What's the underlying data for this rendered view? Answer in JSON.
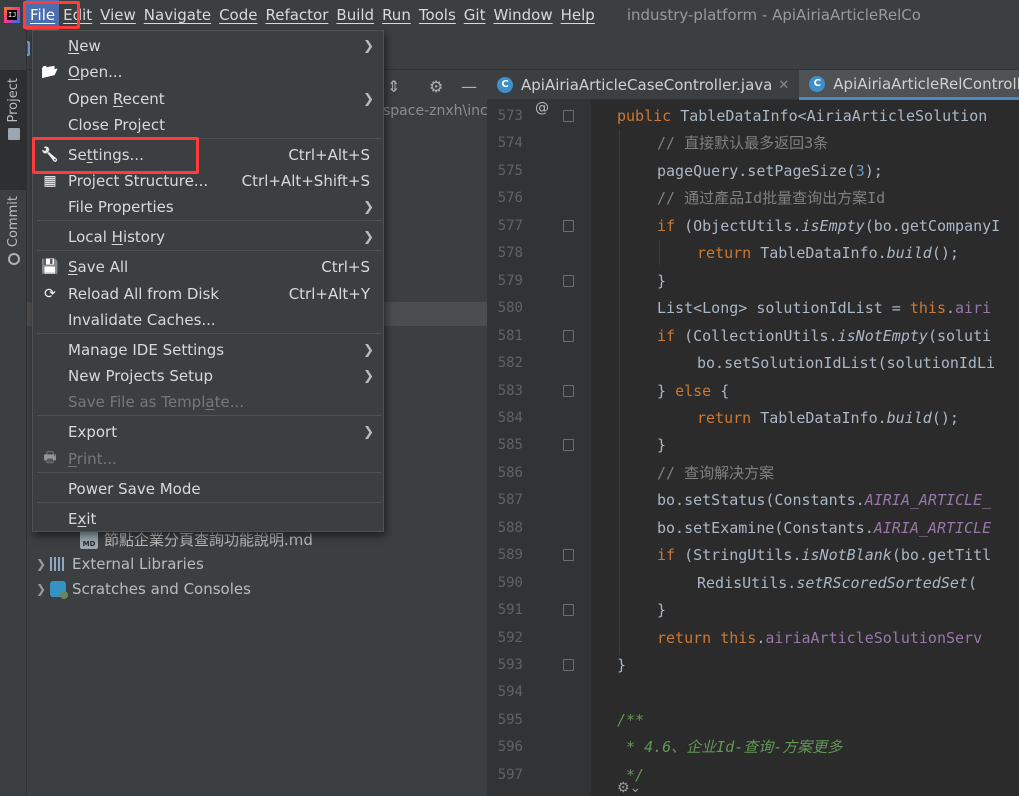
{
  "menubar": {
    "app_icon": "jetbrains-app-icon",
    "items": [
      "File",
      "Edit",
      "View",
      "Navigate",
      "Code",
      "Refactor",
      "Build",
      "Run",
      "Tools",
      "Git",
      "Window",
      "Help"
    ],
    "window_title": "industry-platform - ApiAiriaArticleRelCo"
  },
  "left_stripe": {
    "project_label": "Project",
    "commit_label": "Commit"
  },
  "project_panel": {
    "path_fragment": "space-znxh\\inc",
    "tree": [
      {
        "label": "節點企業分頁查詢功能說明.md",
        "icon": "markdown-file-icon"
      },
      {
        "label": "External Libraries",
        "icon": "library-icon"
      },
      {
        "label": "Scratches and Consoles",
        "icon": "scratches-icon"
      }
    ]
  },
  "editor": {
    "tabs": [
      {
        "label": "ApiAiriaArticleCaseController.java",
        "icon": "java-class-icon",
        "active": false
      },
      {
        "label": "ApiAiriaArticleRelControll",
        "icon": "java-class-icon",
        "active": true
      }
    ],
    "line_numbers": [
      "573",
      "574",
      "575",
      "576",
      "577",
      "578",
      "579",
      "580",
      "581",
      "582",
      "583",
      "584",
      "585",
      "586",
      "587",
      "588",
      "589",
      "590",
      "591",
      "592",
      "593",
      "594",
      "595",
      "596",
      "597"
    ],
    "lines": [
      {
        "indent": 0,
        "parts": [
          [
            "kw",
            "public "
          ],
          [
            "",
            "TableDataInfo<AiriaArticleSolution"
          ]
        ]
      },
      {
        "indent": 1,
        "parts": [
          [
            "cm",
            "// 直接默认最多返回3条"
          ]
        ]
      },
      {
        "indent": 1,
        "parts": [
          [
            "",
            "pageQuery.setPageSize("
          ],
          [
            "num",
            "3"
          ],
          [
            "",
            ");"
          ]
        ]
      },
      {
        "indent": 1,
        "parts": [
          [
            "cm",
            "// 通过產品Id批量查询出方案Id"
          ]
        ]
      },
      {
        "indent": 1,
        "parts": [
          [
            "kw",
            "if "
          ],
          [
            "",
            "(ObjectUtils."
          ],
          [
            "fn",
            "isEmpty"
          ],
          [
            "",
            "(bo.getCompanyI"
          ]
        ]
      },
      {
        "indent": 2,
        "parts": [
          [
            "kw",
            "return "
          ],
          [
            "",
            "TableDataInfo."
          ],
          [
            "fn",
            "build"
          ],
          [
            "",
            "();"
          ]
        ]
      },
      {
        "indent": 1,
        "parts": [
          [
            "",
            "}"
          ]
        ]
      },
      {
        "indent": 1,
        "parts": [
          [
            "",
            "List<Long> solutionIdList = "
          ],
          [
            "kw",
            "this"
          ],
          [
            "",
            "."
          ],
          [
            "fld",
            "airi"
          ]
        ]
      },
      {
        "indent": 1,
        "parts": [
          [
            "kw",
            "if "
          ],
          [
            "",
            "(CollectionUtils."
          ],
          [
            "fn",
            "isNotEmpty"
          ],
          [
            "",
            "(soluti"
          ]
        ]
      },
      {
        "indent": 2,
        "parts": [
          [
            "",
            "bo.setSolutionIdList(solutionIdLi"
          ]
        ]
      },
      {
        "indent": 1,
        "parts": [
          [
            "",
            "} "
          ],
          [
            "kw",
            "else "
          ],
          [
            "",
            "{"
          ]
        ]
      },
      {
        "indent": 2,
        "parts": [
          [
            "kw",
            "return "
          ],
          [
            "",
            "TableDataInfo."
          ],
          [
            "fn",
            "build"
          ],
          [
            "",
            "();"
          ]
        ]
      },
      {
        "indent": 1,
        "parts": [
          [
            "",
            "}"
          ]
        ]
      },
      {
        "indent": 1,
        "parts": [
          [
            "cm",
            "// 查询解决方案"
          ]
        ]
      },
      {
        "indent": 1,
        "parts": [
          [
            "",
            "bo.setStatus(Constants."
          ],
          [
            "cst",
            "AIRIA_ARTICLE_"
          ]
        ]
      },
      {
        "indent": 1,
        "parts": [
          [
            "",
            "bo.setExamine(Constants."
          ],
          [
            "cst",
            "AIRIA_ARTICLE"
          ]
        ]
      },
      {
        "indent": 1,
        "parts": [
          [
            "kw",
            "if "
          ],
          [
            "",
            "(StringUtils."
          ],
          [
            "fn",
            "isNotBlank"
          ],
          [
            "",
            "(bo.getTitl"
          ]
        ]
      },
      {
        "indent": 2,
        "parts": [
          [
            "",
            "RedisUtils."
          ],
          [
            "fn",
            "setRScoredSortedSet"
          ],
          [
            "",
            "( "
          ]
        ]
      },
      {
        "indent": 1,
        "parts": [
          [
            "",
            "}"
          ]
        ]
      },
      {
        "indent": 1,
        "parts": [
          [
            "kw",
            "return this"
          ],
          [
            "",
            "."
          ],
          [
            "fld",
            "airiaArticleSolutionServ"
          ]
        ]
      },
      {
        "indent": 0,
        "parts": [
          [
            "",
            "}"
          ]
        ]
      },
      {
        "indent": 0,
        "parts": [
          [
            "",
            ""
          ]
        ]
      },
      {
        "indent": 0,
        "parts": [
          [
            "doc",
            "/**"
          ]
        ]
      },
      {
        "indent": 0,
        "parts": [
          [
            "doc",
            " * 4.6、企业Id-查询-方案更多"
          ]
        ]
      },
      {
        "indent": 0,
        "parts": [
          [
            "doc",
            " */"
          ]
        ]
      }
    ],
    "gutter_marker": "@"
  },
  "file_menu": {
    "items": [
      {
        "label": "New",
        "shortcut": "",
        "submenu": true,
        "icon": "",
        "disabled": false,
        "underline": 0
      },
      {
        "label": "Open...",
        "shortcut": "",
        "submenu": false,
        "icon": "folder-open-icon",
        "disabled": false,
        "underline": 0
      },
      {
        "label": "Open Recent",
        "shortcut": "",
        "submenu": true,
        "icon": "",
        "disabled": false,
        "underline": 5
      },
      {
        "label": "Close Project",
        "shortcut": "",
        "submenu": false,
        "icon": "",
        "disabled": false,
        "underline": -1
      },
      {
        "label": "Settings...",
        "shortcut": "Ctrl+Alt+S",
        "submenu": false,
        "icon": "wrench-icon",
        "disabled": false,
        "underline": 2
      },
      {
        "label": "Project Structure...",
        "shortcut": "Ctrl+Alt+Shift+S",
        "submenu": false,
        "icon": "project-structure-icon",
        "disabled": false,
        "underline": -1
      },
      {
        "label": "File Properties",
        "shortcut": "",
        "submenu": true,
        "icon": "",
        "disabled": false,
        "underline": -1
      },
      {
        "label": "Local History",
        "shortcut": "",
        "submenu": true,
        "icon": "",
        "disabled": false,
        "underline": 6
      },
      {
        "label": "Save All",
        "shortcut": "Ctrl+S",
        "submenu": false,
        "icon": "save-icon",
        "disabled": false,
        "underline": 0
      },
      {
        "label": "Reload All from Disk",
        "shortcut": "Ctrl+Alt+Y",
        "submenu": false,
        "icon": "reload-icon",
        "disabled": false,
        "underline": -1
      },
      {
        "label": "Invalidate Caches...",
        "shortcut": "",
        "submenu": false,
        "icon": "",
        "disabled": false,
        "underline": -1
      },
      {
        "label": "Manage IDE Settings",
        "shortcut": "",
        "submenu": true,
        "icon": "",
        "disabled": false,
        "underline": -1
      },
      {
        "label": "New Projects Setup",
        "shortcut": "",
        "submenu": true,
        "icon": "",
        "disabled": false,
        "underline": -1
      },
      {
        "label": "Save File as Template...",
        "shortcut": "",
        "submenu": false,
        "icon": "",
        "disabled": true,
        "underline": 18
      },
      {
        "label": "Export",
        "shortcut": "",
        "submenu": true,
        "icon": "",
        "disabled": false,
        "underline": -1
      },
      {
        "label": "Print...",
        "shortcut": "",
        "submenu": false,
        "icon": "print-icon",
        "disabled": true,
        "underline": 0
      },
      {
        "label": "Power Save Mode",
        "shortcut": "",
        "submenu": false,
        "icon": "",
        "disabled": false,
        "underline": -1
      },
      {
        "label": "Exit",
        "shortcut": "",
        "submenu": false,
        "icon": "",
        "disabled": false,
        "underline": 1
      }
    ]
  },
  "colors": {
    "highlight": "#ff3b3b",
    "menu_bg": "#3c3f41",
    "editor_bg": "#2b2b2b",
    "keyword": "#cc7832",
    "comment": "#808080",
    "doc_comment": "#629755",
    "constant": "#9876aa",
    "number": "#6897bb"
  }
}
